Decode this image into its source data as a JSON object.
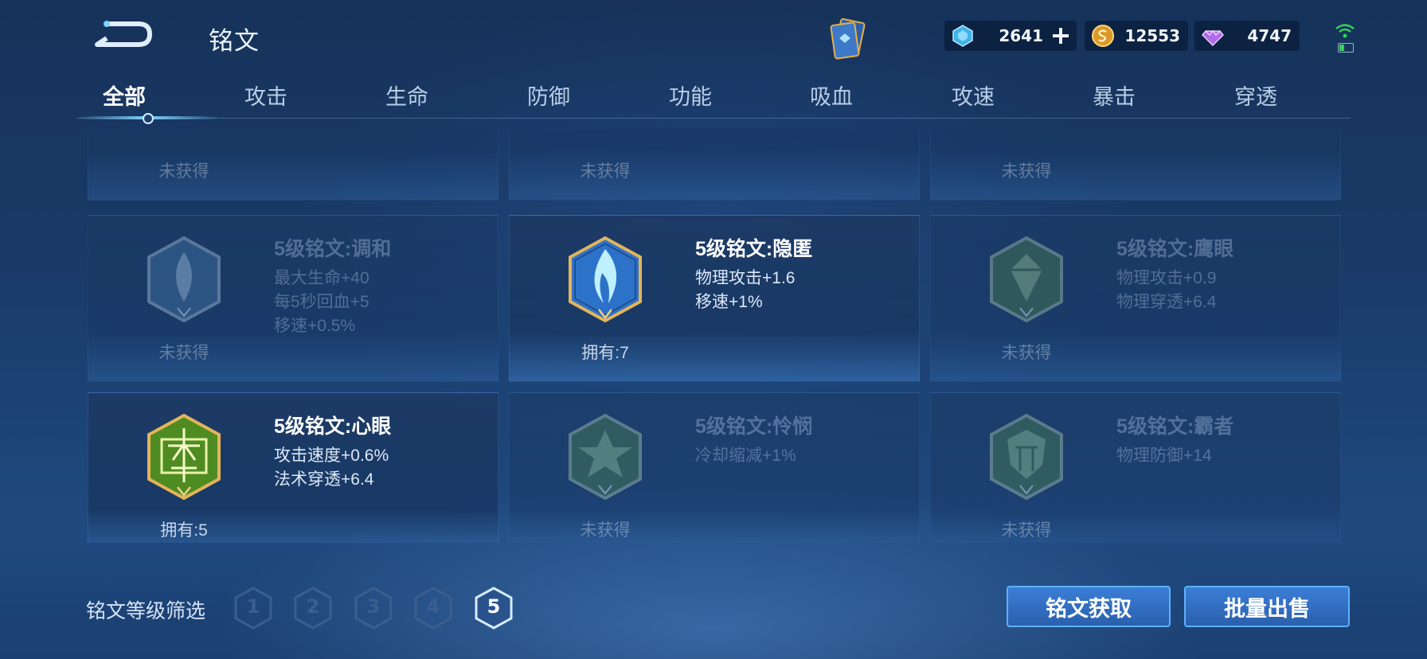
{
  "header": {
    "title": "铭文",
    "currencies": [
      {
        "name": "gem",
        "value": "2641"
      },
      {
        "name": "coin",
        "value": "12553"
      },
      {
        "name": "diamond",
        "value": "4747"
      }
    ]
  },
  "tabs": [
    {
      "label": "全部",
      "active": true
    },
    {
      "label": "攻击"
    },
    {
      "label": "生命"
    },
    {
      "label": "防御"
    },
    {
      "label": "功能"
    },
    {
      "label": "吸血"
    },
    {
      "label": "攻速"
    },
    {
      "label": "暴击"
    },
    {
      "label": "穿透"
    }
  ],
  "cards": [
    {
      "status": "未获得",
      "dim": true
    },
    {
      "status": "未获得",
      "dim": true
    },
    {
      "status": "未获得",
      "dim": true
    },
    {
      "name": "5级铭文:调和",
      "attrs": [
        "最大生命+40",
        "每5秒回血+5",
        "移速+0.5%"
      ],
      "status": "未获得",
      "dim": true,
      "color": "#3d6a9a"
    },
    {
      "name": "5级铭文:隐匿",
      "attrs": [
        "物理攻击+1.6",
        "移速+1%"
      ],
      "status": "拥有:7",
      "dim": false,
      "color": "#2d72c9"
    },
    {
      "name": "5级铭文:鹰眼",
      "attrs": [
        "物理攻击+0.9",
        "物理穿透+6.4"
      ],
      "status": "未获得",
      "dim": true,
      "color": "#3f6f4e"
    },
    {
      "name": "5级铭文:心眼",
      "attrs": [
        "攻击速度+0.6%",
        "法术穿透+6.4"
      ],
      "status": "拥有:5",
      "dim": false,
      "color": "#4e8c22"
    },
    {
      "name": "5级铭文:怜悯",
      "attrs": [
        "冷却缩减+1%"
      ],
      "status": "未获得",
      "dim": true,
      "color": "#3f6f4e"
    },
    {
      "name": "5级铭文:霸者",
      "attrs": [
        "物理防御+14"
      ],
      "status": "未获得",
      "dim": true,
      "color": "#3f6f4e"
    }
  ],
  "filter": {
    "label": "铭文等级筛选",
    "levels": [
      "1",
      "2",
      "3",
      "4",
      "5"
    ],
    "selected": "5"
  },
  "actions": {
    "acquire_label": "铭文获取",
    "sell_label": "批量出售"
  },
  "colors": {
    "accent": "#5fb0ff",
    "button": "#2f6cc0",
    "background": "#1a3c6a"
  }
}
